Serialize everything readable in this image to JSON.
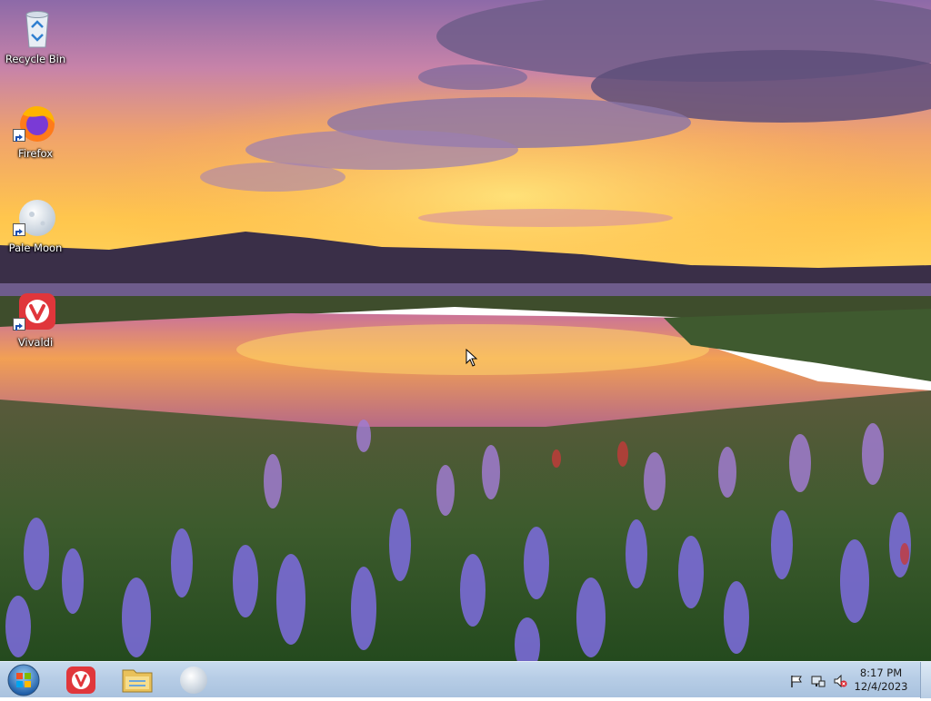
{
  "desktop": {
    "icons": [
      {
        "label": "Recycle Bin",
        "icon": "recycle-bin-icon"
      },
      {
        "label": "Firefox",
        "icon": "firefox-icon"
      },
      {
        "label": "Pale Moon",
        "icon": "pale-moon-icon"
      },
      {
        "label": "Vivaldi",
        "icon": "vivaldi-icon"
      }
    ]
  },
  "taskbar": {
    "start_icon": "windows-start-icon",
    "pinned": [
      {
        "name": "Vivaldi",
        "icon": "vivaldi-icon"
      },
      {
        "name": "Windows Explorer",
        "icon": "folder-icon"
      },
      {
        "name": "Pale Moon",
        "icon": "pale-moon-icon"
      }
    ],
    "tray": {
      "icons": [
        "action-center-flag-icon",
        "network-icon",
        "volume-muted-icon"
      ],
      "time": "8:17 PM",
      "date": "12/4/2023"
    }
  },
  "colors": {
    "taskbar": "#b7cde6",
    "vivaldi_red": "#e0363b",
    "firefox_orange": "#ff7b1a"
  }
}
